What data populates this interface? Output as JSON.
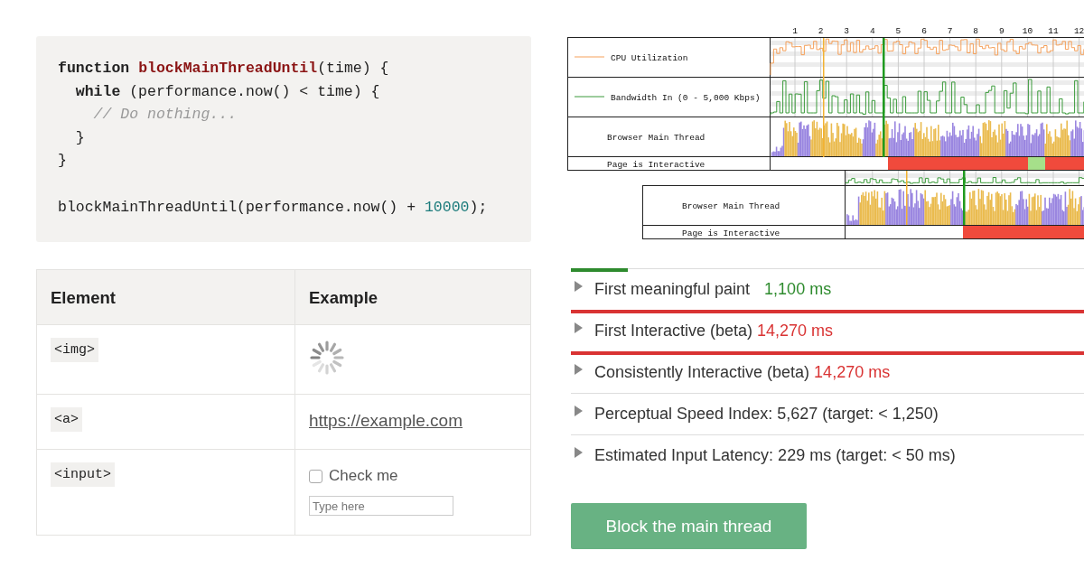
{
  "code": {
    "blocks": [
      [
        [
          {
            "text": "function ",
            "kind": "keyword"
          },
          {
            "text": "blockMainThreadUntil",
            "kind": "function"
          },
          {
            "text": "(time) {",
            "kind": "plain"
          }
        ],
        [
          {
            "text": "  while",
            "kind": "keyword"
          },
          {
            "text": " (performance.now() < time) {",
            "kind": "plain"
          }
        ],
        [
          {
            "text": "    // Do nothing...",
            "kind": "comment"
          }
        ],
        [
          {
            "text": "  }",
            "kind": "plain"
          }
        ],
        [
          {
            "text": "}",
            "kind": "plain"
          }
        ]
      ],
      [
        [
          {
            "text": "blockMainThreadUntil(performance.now() + ",
            "kind": "plain"
          },
          {
            "text": "10000",
            "kind": "number"
          },
          {
            "text": ");",
            "kind": "plain"
          }
        ]
      ]
    ]
  },
  "table": {
    "columns": [
      "Element",
      "Example"
    ],
    "rows": [
      {
        "element": "<img>",
        "example": {
          "kind": "spinner"
        }
      },
      {
        "element": "<a>",
        "example": {
          "kind": "link",
          "text": "https://example.com"
        }
      },
      {
        "element": "<input>",
        "example": {
          "kind": "inputs",
          "checkbox": {
            "label": "Check me",
            "checked": false
          },
          "field": {
            "placeholder": "Type here"
          }
        }
      }
    ]
  },
  "timeline": {
    "ticks": [
      "1",
      "2",
      "3",
      "4",
      "5",
      "6",
      "7",
      "8",
      "9",
      "10",
      "11",
      "12"
    ],
    "panels": [
      {
        "rows": [
          {
            "kind": "cpu",
            "label": "CPU Utilization"
          },
          {
            "kind": "bandwidth",
            "label": "Bandwidth In (0 - 5,000 Kbps)"
          },
          {
            "kind": "thread",
            "label": "Browser Main Thread"
          },
          {
            "kind": "interactive",
            "label": "Page is Interactive"
          }
        ]
      },
      {
        "rows": [
          {
            "kind": "bandwidth"
          },
          {
            "kind": "thread",
            "label": "Browser Main Thread"
          },
          {
            "kind": "interactive",
            "label": "Page is Interactive"
          }
        ]
      }
    ]
  },
  "metrics": [
    {
      "label": "First meaningful paint",
      "value": "1,100 ms",
      "kind": "pass"
    },
    {
      "label": "First Interactive (beta)",
      "value": "14,270 ms",
      "kind": "fail"
    },
    {
      "label": "Consistently Interactive (beta)",
      "value": "14,270 ms",
      "kind": "fail"
    },
    {
      "label": "Perceptual Speed Index: 5,627 (target: < 1,250)",
      "kind": "plain"
    },
    {
      "label": "Estimated Input Latency: 229 ms (target: < 50 ms)",
      "kind": "plain"
    }
  ],
  "button": "Block the main thread"
}
